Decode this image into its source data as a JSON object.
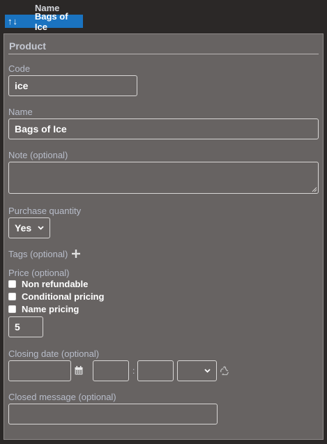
{
  "list": {
    "column_header": "Name",
    "selected_row": {
      "label": "Bags of Ice"
    }
  },
  "form": {
    "section_title": "Product",
    "code": {
      "label": "Code",
      "value": "ice"
    },
    "name": {
      "label": "Name",
      "value": "Bags of Ice"
    },
    "note": {
      "label": "Note (optional)",
      "value": ""
    },
    "purchase_quantity": {
      "label": "Purchase quantity",
      "selected": "Yes"
    },
    "tags": {
      "label": "Tags (optional)"
    },
    "price": {
      "label": "Price (optional)",
      "options": [
        {
          "label": "Non refundable",
          "checked": false
        },
        {
          "label": "Conditional pricing",
          "checked": false
        },
        {
          "label": "Name pricing",
          "checked": false
        }
      ],
      "value": "5"
    },
    "closing_date": {
      "label": "Closing date (optional)",
      "date": "",
      "hour": "",
      "minute": "",
      "ampm": "",
      "separator": ":"
    },
    "closed_message": {
      "label": "Closed message (optional)",
      "value": ""
    }
  },
  "icons": {
    "sort_up": "arrow-up-icon",
    "sort_down": "arrow-down-icon",
    "add_tag": "plus-icon",
    "calendar": "calendar-icon",
    "reset": "recycle-icon"
  },
  "colors": {
    "background": "#2b2827",
    "panel": "#676362",
    "selection": "#1a73c0",
    "label": "#b8bdca"
  }
}
